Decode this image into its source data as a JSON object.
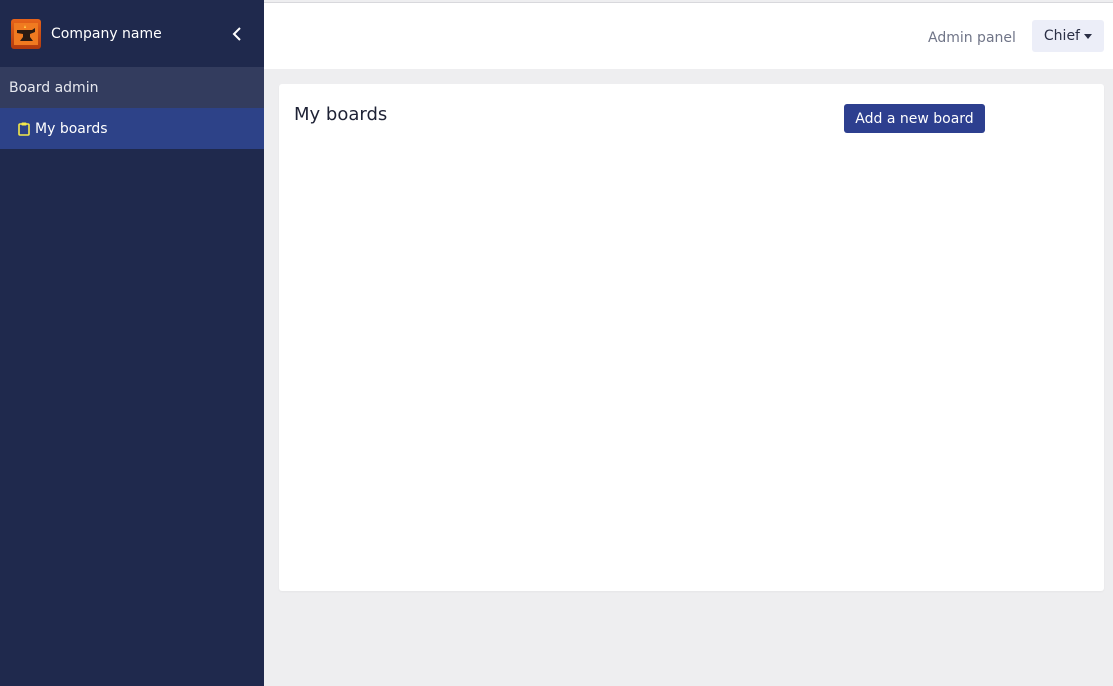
{
  "sidebar": {
    "company_name": "Company name",
    "logo_icon": "anvil-logo-icon",
    "collapse_icon": "chevron-left-icon",
    "section_title": "Board admin",
    "items": [
      {
        "label": "My boards",
        "icon": "clipboard-icon",
        "active": true
      }
    ]
  },
  "topbar": {
    "admin_link": "Admin panel",
    "user_menu": "Chief"
  },
  "main": {
    "title": "My boards",
    "add_button": "Add a new board"
  },
  "colors": {
    "sidebar_bg": "#1f294d",
    "active_item": "#2d4288",
    "accent_button": "#2d3f8f",
    "icon_yellow": "#f5e94a"
  }
}
